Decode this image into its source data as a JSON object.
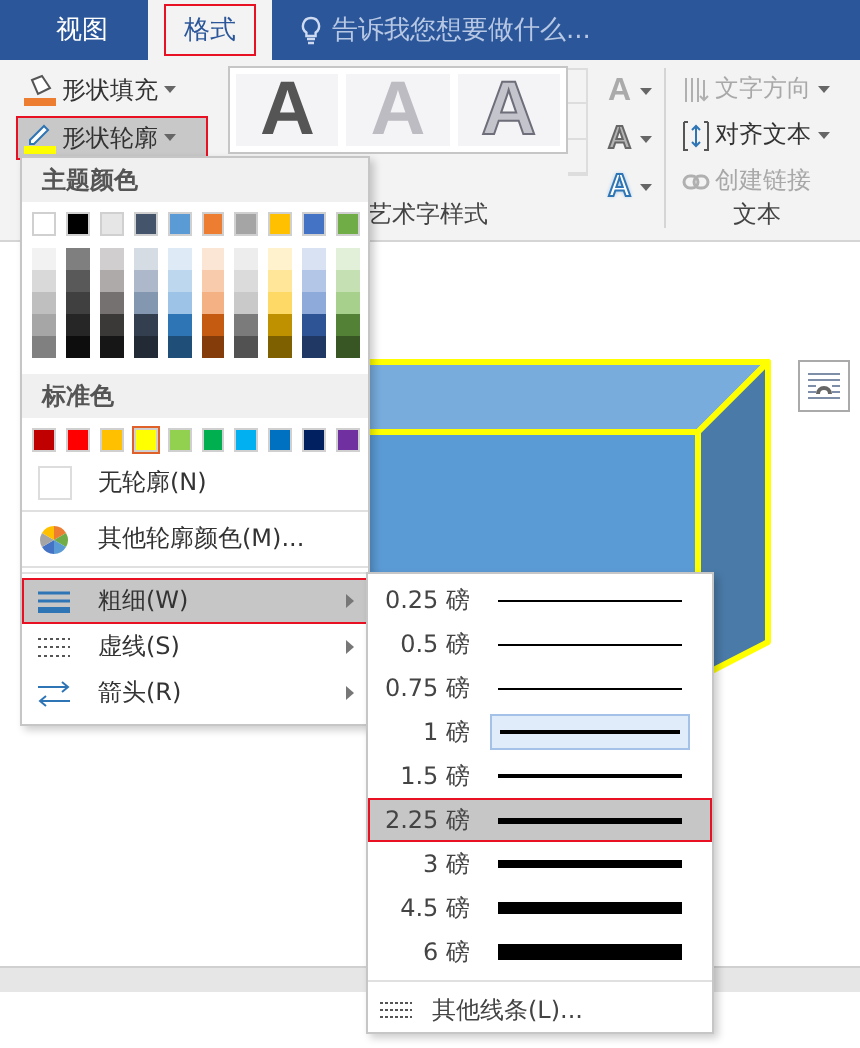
{
  "tabs": [
    {
      "label": "视图",
      "selected": false
    },
    {
      "label": "格式",
      "selected": true
    }
  ],
  "tell_me": {
    "placeholder": "告诉我您想要做什么..."
  },
  "ribbon": {
    "shape_styles": [
      {
        "label": "形状填充",
        "kind": "fill",
        "selected": false
      },
      {
        "label": "形状轮廓",
        "kind": "outline",
        "selected": true
      }
    ],
    "wordart_group": {
      "label": "艺术字样式",
      "styles": [
        {
          "text": "A",
          "kind": "dark"
        },
        {
          "text": "A",
          "kind": "light"
        },
        {
          "text": "A",
          "kind": "outlined"
        }
      ],
      "effects": [
        {
          "text": "A",
          "kind": "fill"
        },
        {
          "text": "A",
          "kind": "outline"
        },
        {
          "text": "A",
          "kind": "glow"
        }
      ]
    },
    "text_group": {
      "label": "文本",
      "items": [
        {
          "label": "文字方向",
          "kind": "direction",
          "disabled": true
        },
        {
          "label": "对齐文本",
          "kind": "align",
          "disabled": false
        },
        {
          "label": "创建链接",
          "kind": "link",
          "disabled": true
        }
      ]
    }
  },
  "outline_menu": {
    "theme_title": "主题颜色",
    "theme_colors": [
      {
        "color": "#ffffff",
        "shades": [
          {
            "color": "#f2f2f2"
          },
          {
            "color": "#d9d9d9"
          },
          {
            "color": "#bfbfbf"
          },
          {
            "color": "#a6a6a6"
          },
          {
            "color": "#808080"
          }
        ]
      },
      {
        "color": "#000000",
        "shades": [
          {
            "color": "#7f7f7f"
          },
          {
            "color": "#595959"
          },
          {
            "color": "#404040"
          },
          {
            "color": "#262626"
          },
          {
            "color": "#0d0d0d"
          }
        ]
      },
      {
        "color": "#e7e6e6",
        "shades": [
          {
            "color": "#d0cece"
          },
          {
            "color": "#aeaaaa"
          },
          {
            "color": "#767171"
          },
          {
            "color": "#3b3838"
          },
          {
            "color": "#171616"
          }
        ]
      },
      {
        "color": "#44546a",
        "shades": [
          {
            "color": "#d6dce4"
          },
          {
            "color": "#adb9ca"
          },
          {
            "color": "#8497b0"
          },
          {
            "color": "#333f4f"
          },
          {
            "color": "#222a35"
          }
        ]
      },
      {
        "color": "#5b9bd5",
        "shades": [
          {
            "color": "#deebf6"
          },
          {
            "color": "#bdd7ee"
          },
          {
            "color": "#9dc3e6"
          },
          {
            "color": "#2e75b5"
          },
          {
            "color": "#1f4e79"
          }
        ]
      },
      {
        "color": "#ed7d31",
        "shades": [
          {
            "color": "#fbe5d5"
          },
          {
            "color": "#f7cbac"
          },
          {
            "color": "#f4b183"
          },
          {
            "color": "#c55a11"
          },
          {
            "color": "#843c0b"
          }
        ]
      },
      {
        "color": "#a5a5a5",
        "shades": [
          {
            "color": "#ededed"
          },
          {
            "color": "#dbdbdb"
          },
          {
            "color": "#c9c9c9"
          },
          {
            "color": "#7b7b7b"
          },
          {
            "color": "#525252"
          }
        ]
      },
      {
        "color": "#ffc000",
        "shades": [
          {
            "color": "#fff2cc"
          },
          {
            "color": "#ffe699"
          },
          {
            "color": "#ffd966"
          },
          {
            "color": "#bf9000"
          },
          {
            "color": "#7f6000"
          }
        ]
      },
      {
        "color": "#4472c4",
        "shades": [
          {
            "color": "#d9e2f3"
          },
          {
            "color": "#b4c6e7"
          },
          {
            "color": "#8eaadb"
          },
          {
            "color": "#2f5496"
          },
          {
            "color": "#1f3864"
          }
        ]
      },
      {
        "color": "#70ad47",
        "shades": [
          {
            "color": "#e2efd9"
          },
          {
            "color": "#c5e0b3"
          },
          {
            "color": "#a8d08d"
          },
          {
            "color": "#538135"
          },
          {
            "color": "#375623"
          }
        ]
      }
    ],
    "standard_title": "标准色",
    "standard_colors": [
      {
        "color": "#c00000",
        "selected": false
      },
      {
        "color": "#ff0000",
        "selected": false
      },
      {
        "color": "#ffc000",
        "selected": false
      },
      {
        "color": "#ffff00",
        "selected": true
      },
      {
        "color": "#92d050",
        "selected": false
      },
      {
        "color": "#00b050",
        "selected": false
      },
      {
        "color": "#00b0f0",
        "selected": false
      },
      {
        "color": "#0070c0",
        "selected": false
      },
      {
        "color": "#002060",
        "selected": false
      },
      {
        "color": "#7030a0",
        "selected": false
      }
    ],
    "items": [
      {
        "kind": "none",
        "label": "无轮廓(N)",
        "selected": false
      },
      {
        "kind": "more",
        "label": "其他轮廓颜色(M)...",
        "selected": false
      },
      {
        "kind": "weight",
        "label": "粗细(W)",
        "selected": true
      },
      {
        "kind": "dash",
        "label": "虚线(S)",
        "selected": false
      },
      {
        "kind": "arrow",
        "label": "箭头(R)",
        "selected": false
      }
    ]
  },
  "weight_menu": {
    "items": [
      {
        "label": "0.25 磅",
        "selected": false,
        "checked": false
      },
      {
        "label": "0.5 磅",
        "selected": false,
        "checked": false
      },
      {
        "label": "0.75 磅",
        "selected": false,
        "checked": false
      },
      {
        "label": "1 磅",
        "selected": false,
        "checked": true
      },
      {
        "label": "1.5 磅",
        "selected": false,
        "checked": false
      },
      {
        "label": "2.25 磅",
        "selected": true,
        "checked": false
      },
      {
        "label": "3 磅",
        "selected": false,
        "checked": false
      },
      {
        "label": "4.5 磅",
        "selected": false,
        "checked": false
      },
      {
        "label": "6 磅",
        "selected": false,
        "checked": false
      }
    ],
    "more": {
      "label": "其他线条(L)...",
      "selected": false
    }
  }
}
